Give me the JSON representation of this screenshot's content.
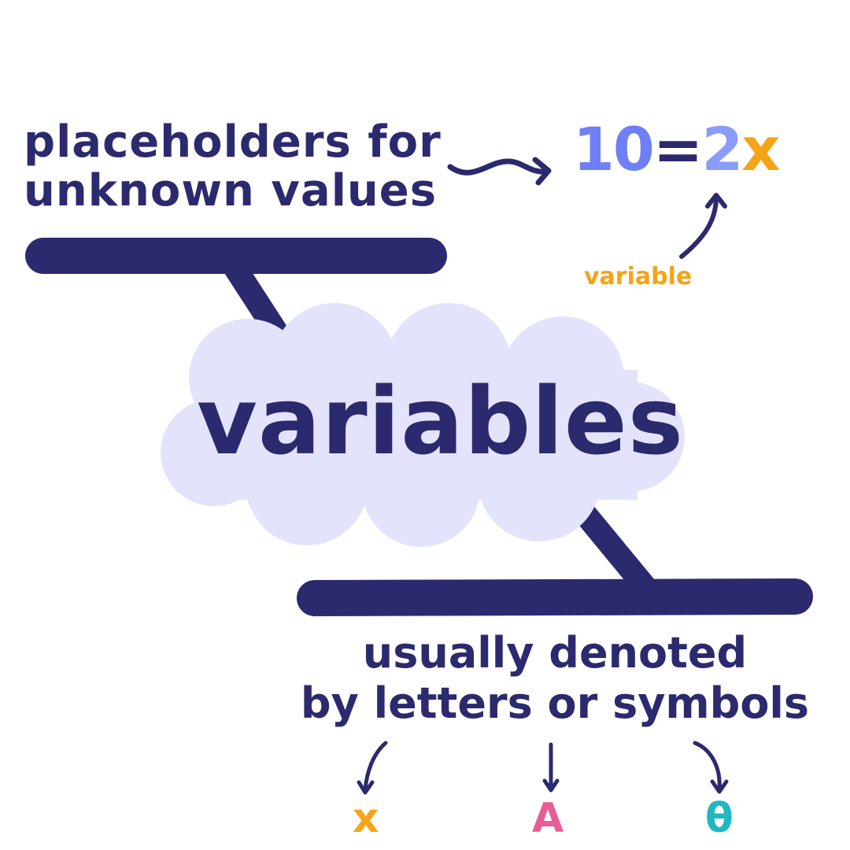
{
  "colors": {
    "ink": "#2c2a6e",
    "cloud": "#e3e4fb",
    "number": "#6f7ff5",
    "coefficient": "#8a9bf8",
    "variable": "#f5a317",
    "letter_a": "#e85d96",
    "letter_theta": "#1fb7c2",
    "background": "#ffffff"
  },
  "top_description": {
    "line1": "placeholders for",
    "line2": "unknown values"
  },
  "equation": {
    "lhs": "10",
    "equals": "=",
    "coefficient": "2",
    "variable": "x"
  },
  "variable_note": "variable",
  "title": "variables",
  "bottom_description": {
    "line1": "usually denoted",
    "line2": "by letters or symbols"
  },
  "examples": {
    "x": "x",
    "a": "A",
    "theta": "θ"
  }
}
